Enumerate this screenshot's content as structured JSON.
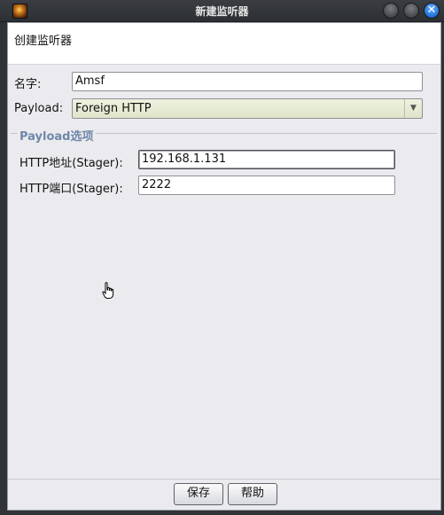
{
  "window": {
    "title": "新建监听器",
    "icon": "cobalt-strike-app-icon",
    "close_glyph": "✕"
  },
  "dialog": {
    "header": "创建监听器",
    "name_label": "名字:",
    "name_value": "Amsf",
    "payload_label": "Payload:",
    "payload_value": "Foreign HTTP",
    "payload_arrow": "▼",
    "group_title": "Payload选项",
    "http_host_label": "HTTP地址(Stager):",
    "http_host_value": "192.168.1.131",
    "http_port_label": "HTTP端口(Stager):",
    "http_port_value": "2222"
  },
  "buttons": {
    "save": "保存",
    "help": "帮助"
  },
  "colors": {
    "group_title": "#6f87a8",
    "close_button": "#1f6fd6",
    "combo_background": "#dfe4c9"
  }
}
